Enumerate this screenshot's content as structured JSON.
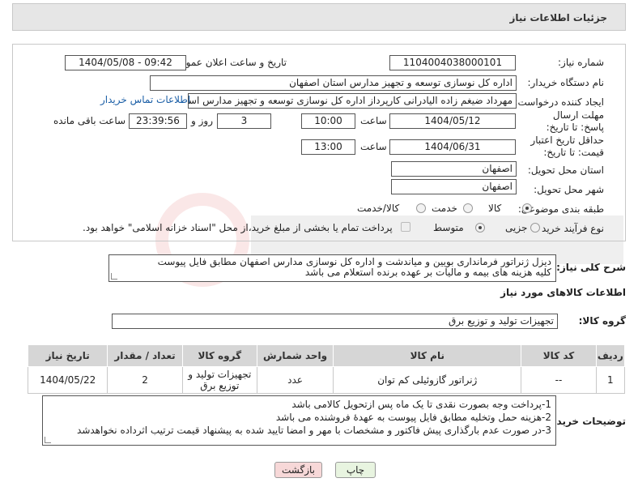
{
  "header": {
    "title": "جزئیات اطلاعات نیاز"
  },
  "form": {
    "need_number": {
      "label": "شماره نیاز:",
      "value": "1104004038000101"
    },
    "announce": {
      "label": "تاریخ و ساعت اعلان عمومی:",
      "value": "1404/05/08 - 09:42"
    },
    "buyer": {
      "label": "نام دستگاه خریدار:",
      "value": "اداره کل نوسازی  توسعه و تجهیز مدارس استان اصفهان"
    },
    "creator": {
      "label": "ایجاد کننده درخواست:",
      "value": "مهرداد ضیغم زاده الیادرانی کارپرداز اداره کل نوسازی  توسعه و تجهیز مدارس استان اصفهان",
      "contact_link": "اطلاعات تماس خریدار"
    },
    "deadline": {
      "label": "مهلت ارسال پاسخ: تا تاریخ:",
      "date": "1404/05/12",
      "time_label": "ساعت",
      "time": "10:00",
      "days": "3",
      "days_label": "روز و",
      "remaining": "23:39:56",
      "remaining_label": "ساعت باقی مانده"
    },
    "validity": {
      "label": "حداقل تاریخ اعتبار قیمت: تا تاریخ:",
      "date": "1404/06/31",
      "time_label": "ساعت",
      "time": "13:00"
    },
    "province": {
      "label": "استان محل تحویل:",
      "value": "اصفهان"
    },
    "city": {
      "label": "شهر محل تحویل:",
      "value": "اصفهان"
    },
    "category": {
      "label": "طبقه بندی موضوعی:",
      "options": [
        "کالا",
        "خدمت",
        "کالا/خدمت"
      ],
      "selected": "کالا"
    },
    "process": {
      "label": "نوع فرآیند خرید :",
      "options": [
        "جزیی",
        "متوسط"
      ],
      "selected": "متوسط",
      "note": "پرداخت تمام یا بخشی از مبلغ خرید،از محل \"اسناد خزانه اسلامی\" خواهد بود."
    }
  },
  "description": {
    "label": "شرح کلی نیاز:",
    "line1": "دیزل ژنراتور فرمانداری بویین و میاندشت و اداره کل نوسازی مدارس اصفهان مطابق فایل پیوست",
    "line2": "کلیه هزینه های بیمه و مالیات بر عهده برنده استعلام می باشد"
  },
  "goods_section": {
    "title": "اطلاعات کالاهای مورد نیاز",
    "group_label": "گروه کالا:",
    "group_value": "تجهیزات تولید و توزیع برق"
  },
  "table": {
    "headers": [
      "ردیف",
      "کد کالا",
      "نام کالا",
      "واحد شمارش",
      "گروه کالا",
      "تعداد / مقدار",
      "تاریخ نیاز"
    ],
    "rows": [
      {
        "row": "1",
        "code": "--",
        "name": "ژنراتور گازوئیلی کم توان",
        "unit": "عدد",
        "group": "تجهیزات تولید و توزیع برق",
        "qty": "2",
        "date": "1404/05/22"
      }
    ]
  },
  "buyer_notes": {
    "label": "توضیحات خریدار:",
    "line1": "1-پرداخت وجه بصورت نقدی تا یک ماه پس ازتحویل کالامی باشد",
    "line2": "2-هزینه حمل وتخلیه مطابق فایل پیوست به عهدۀ فروشنده می باشد",
    "line3": "3-در صورت عدم بارگذاری پیش فاکتور و مشخصات با مهر و امضا تایید شده به پیشنهاد قیمت ترتیب اثرداده نخواهدشد"
  },
  "buttons": {
    "print": "چاپ",
    "back": "بازگشت"
  },
  "colors": {
    "panel_bg": "#e6e6e6",
    "link": "#1a5ea6",
    "back_bg": "#f7d8d8",
    "print_bg": "#e8f4e0"
  }
}
